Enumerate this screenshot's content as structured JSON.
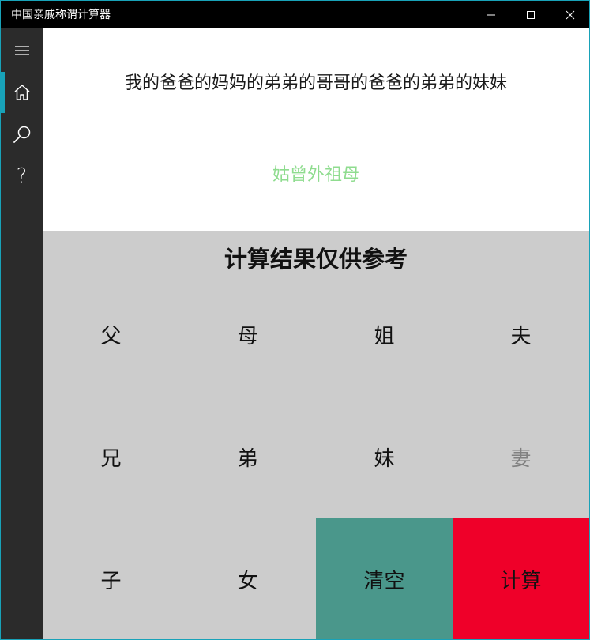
{
  "window": {
    "title": "中国亲戚称谓计算器"
  },
  "sidebar": {
    "items": [
      {
        "icon": "hamburger-menu-icon"
      },
      {
        "icon": "home-icon",
        "active": true
      },
      {
        "icon": "search-icon"
      },
      {
        "icon": "help-icon",
        "glyph": "?"
      }
    ]
  },
  "display": {
    "expression": "我的爸爸的妈妈的弟弟的哥哥的爸爸的弟弟的妹妹",
    "result": "姑曾外祖母"
  },
  "notice": "计算结果仅供参考",
  "keypad": {
    "keys": [
      {
        "label": "父"
      },
      {
        "label": "母"
      },
      {
        "label": "姐"
      },
      {
        "label": "夫"
      },
      {
        "label": "兄"
      },
      {
        "label": "弟"
      },
      {
        "label": "妹"
      },
      {
        "label": "妻",
        "disabled": true
      },
      {
        "label": "子"
      },
      {
        "label": "女"
      },
      {
        "label": "清空"
      },
      {
        "label": "计算"
      }
    ]
  },
  "colors": {
    "accent": "#18a2b8",
    "sidebar_bg": "#2b2b2b",
    "result_text": "#8fdc8f",
    "clear_button": "#4a978b",
    "calculate_button": "#ef0029",
    "keypad_bg": "#cccccc"
  }
}
